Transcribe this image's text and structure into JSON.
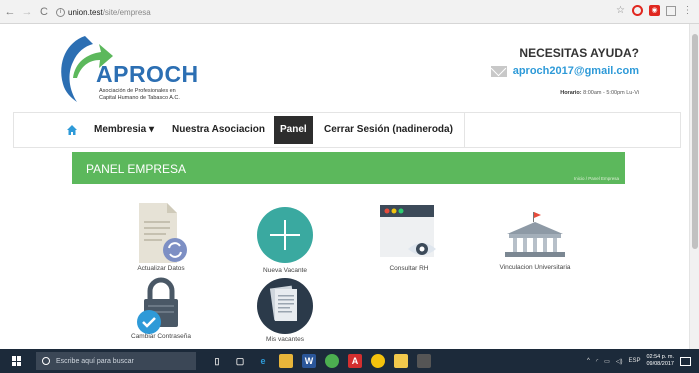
{
  "browser": {
    "back": "←",
    "forward": "→",
    "reload": "C",
    "url_host": "union.test",
    "url_path": "/site/empresa",
    "star": "☆"
  },
  "header": {
    "logo_text": "APROCH",
    "logo_subtitle_1": "Asociación de Profesionales en",
    "logo_subtitle_2": "Capital Humano de Tabasco A.C.",
    "help_title": "NECESITAS AYUDA?",
    "help_email": "aproch2017@gmail.com",
    "horario_label": "Horario:",
    "horario_value": "8:00am - 5:00pm Lu-Vi"
  },
  "nav": {
    "items": [
      {
        "label": "Membresia ▾"
      },
      {
        "label": "Nuestra Asociacion"
      },
      {
        "label": "Panel"
      },
      {
        "label": "Cerrar Sesión (nadineroda)"
      }
    ]
  },
  "banner": {
    "title": "PANEL EMPRESA",
    "breadcrumb": "Inicio  /  Panel Empresa"
  },
  "tiles": [
    {
      "label": "Actualizar Datos",
      "icon": "document-refresh-icon"
    },
    {
      "label": "Nueva Vacante",
      "icon": "plus-circle-icon"
    },
    {
      "label": "Consultar RH",
      "icon": "browser-eye-icon"
    },
    {
      "label": "Vinculacion Universitaria",
      "icon": "university-building-icon"
    },
    {
      "label": "Cambiar Contraseña",
      "icon": "lock-check-icon"
    },
    {
      "label": "Mis vacantes",
      "icon": "documents-circle-icon"
    }
  ],
  "taskbar": {
    "search_placeholder": "Escribe aquí para buscar",
    "lang": "ESP",
    "time": "02:54 p. m.",
    "date": "09/08/2017"
  },
  "colors": {
    "brand_blue": "#2c6fb3",
    "brand_green": "#5cb85c",
    "email_blue": "#2e9ad8",
    "teal": "#3aa9a0",
    "dark_navy": "#2b3a4a"
  }
}
